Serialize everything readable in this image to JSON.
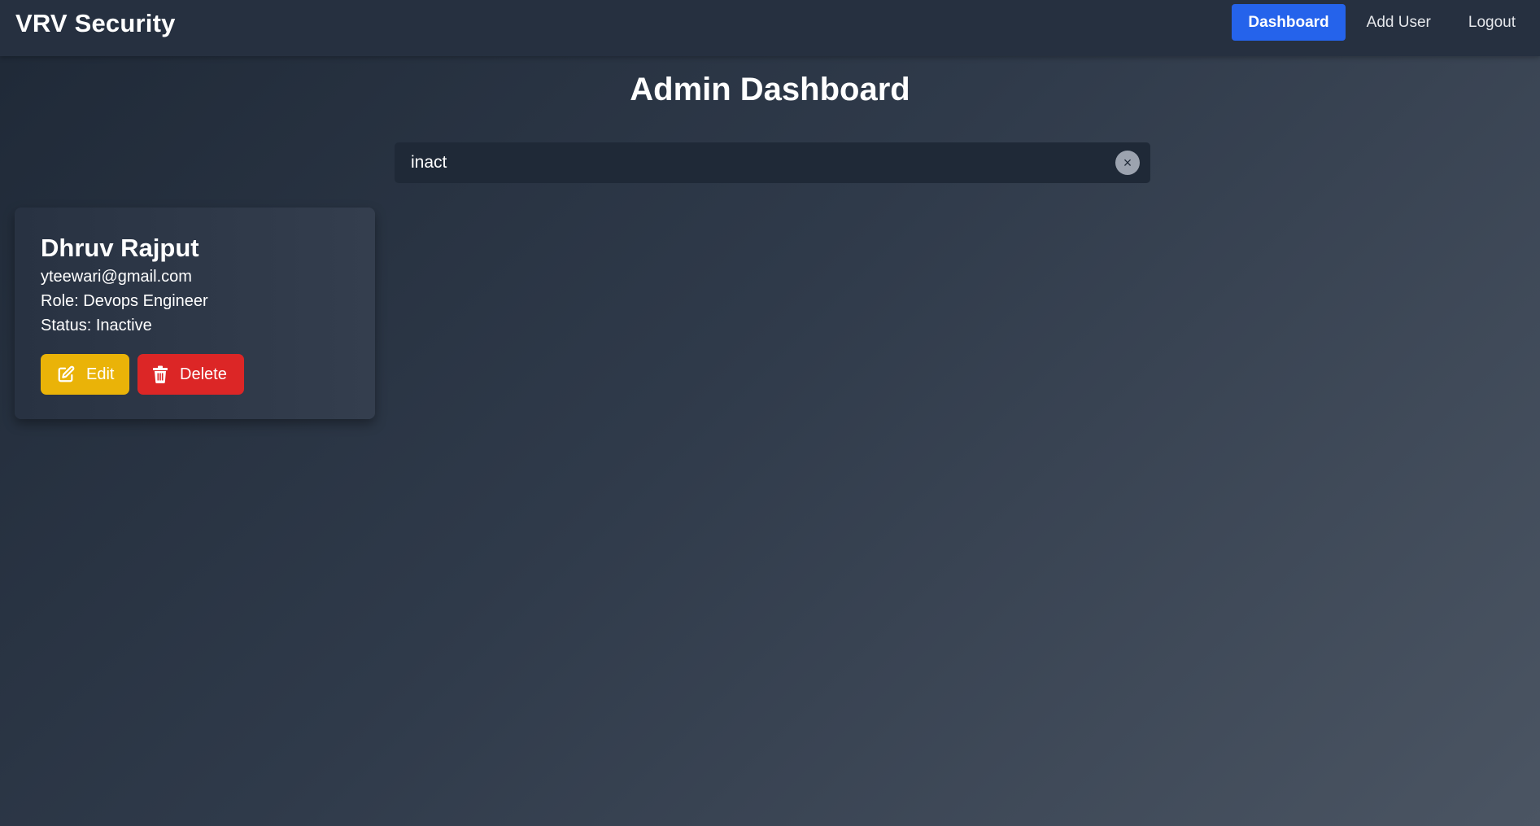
{
  "app": {
    "brand": "VRV Security"
  },
  "nav": {
    "items": [
      {
        "label": "Dashboard",
        "active": true
      },
      {
        "label": "Add User",
        "active": false
      },
      {
        "label": "Logout",
        "active": false
      }
    ]
  },
  "main": {
    "title": "Admin Dashboard"
  },
  "search": {
    "value": "inact",
    "clear_icon": "×"
  },
  "users": [
    {
      "name": "Dhruv Rajput",
      "email": "yteewari@gmail.com",
      "role": "Role: Devops Engineer",
      "status": "Status: Inactive",
      "edit_label": "Edit",
      "delete_label": "Delete"
    }
  ],
  "colors": {
    "accent": "#2563eb",
    "edit": "#eab308",
    "delete": "#dc2626"
  },
  "icons": {
    "edit": "edit-icon",
    "delete": "trash-icon",
    "clear": "close-icon"
  }
}
